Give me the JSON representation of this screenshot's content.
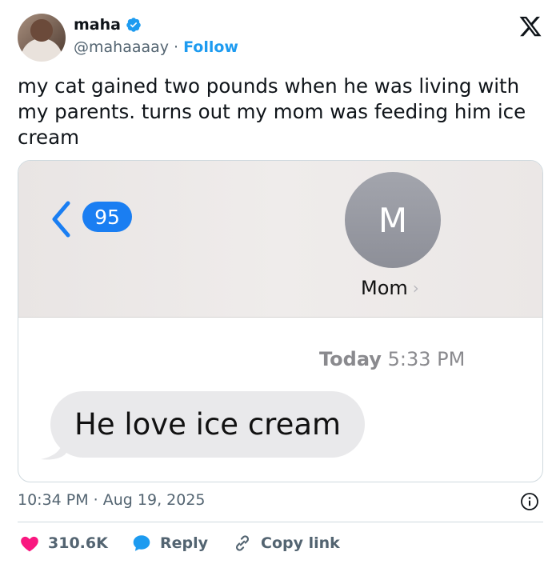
{
  "author": {
    "name": "maha",
    "handle": "@mahaaaay",
    "separator": "·",
    "follow_label": "Follow"
  },
  "icons": {
    "verified": "verified-badge-icon",
    "logo": "x-logo-icon",
    "info": "info-icon",
    "like": "heart-icon",
    "reply": "speech-bubble-icon",
    "copy": "link-icon"
  },
  "tweet": {
    "text": "my cat gained two pounds when he was living with my parents. turns out my mom was feeding him ice cream"
  },
  "screenshot": {
    "unread_count": "95",
    "contact_initial": "M",
    "contact_name": "Mom",
    "contact_chevron": "›",
    "timestamp_day": "Today",
    "timestamp_time": "5:33 PM",
    "message": "He love ice cream"
  },
  "meta": {
    "posted_at": "10:34 PM · Aug 19, 2025"
  },
  "actions": {
    "like_count": "310.6K",
    "reply_label": "Reply",
    "copy_label": "Copy link"
  },
  "colors": {
    "accent": "#1d9bf0",
    "like": "#f91880",
    "imessage_blue": "#1a7ef2"
  }
}
